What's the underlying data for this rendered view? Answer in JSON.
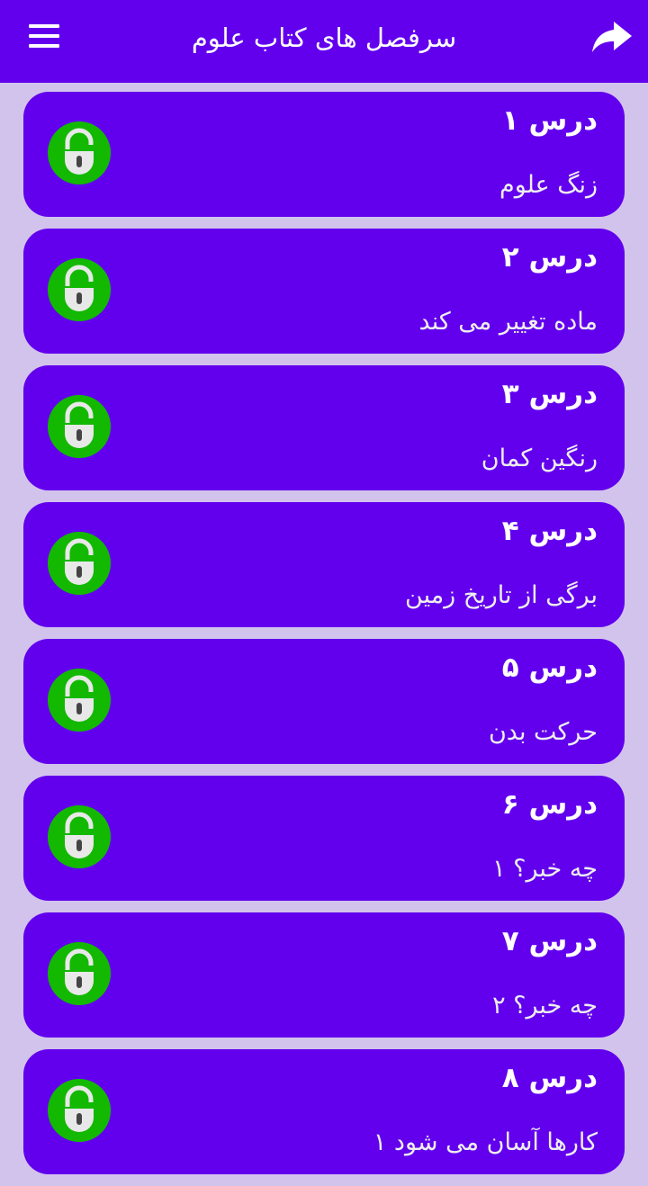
{
  "appbar": {
    "title": "سرفصل های کتاب علوم",
    "menu_icon": "hamburger-menu-icon",
    "share_icon": "share-arrow-icon"
  },
  "colors": {
    "primary": "#6200ee",
    "background": "#d2c3ec",
    "lock_green": "#12b900",
    "lock_white": "#e8e8e8"
  },
  "lessons": [
    {
      "title": "درس ۱",
      "subtitle": "زنگ علوم",
      "icon": "unlocked-padlock-icon"
    },
    {
      "title": "درس ۲",
      "subtitle": "ماده تغییر می کند",
      "icon": "unlocked-padlock-icon"
    },
    {
      "title": "درس ۳",
      "subtitle": "رنگین کمان",
      "icon": "unlocked-padlock-icon"
    },
    {
      "title": "درس ۴",
      "subtitle": "برگی از تاریخ زمین",
      "icon": "unlocked-padlock-icon"
    },
    {
      "title": "درس ۵",
      "subtitle": "حرکت بدن",
      "icon": "unlocked-padlock-icon"
    },
    {
      "title": "درس ۶",
      "subtitle": "چه خبر؟ ۱",
      "icon": "unlocked-padlock-icon"
    },
    {
      "title": "درس ۷",
      "subtitle": "چه خبر؟ ۲",
      "icon": "unlocked-padlock-icon"
    },
    {
      "title": "درس ۸",
      "subtitle": "کارها آسان می شود ۱",
      "icon": "unlocked-padlock-icon"
    }
  ]
}
